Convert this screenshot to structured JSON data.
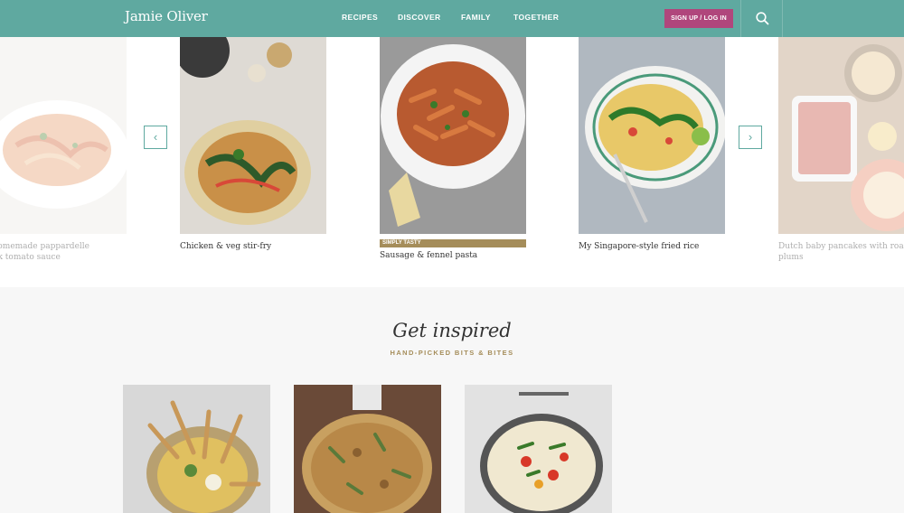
{
  "header": {
    "logo": "Jamie Oliver",
    "nav": [
      "RECIPES",
      "DISCOVER",
      "FAMILY",
      "TOGETHER"
    ],
    "signup_label": "SIGN UP / LOG IN"
  },
  "carousel": {
    "cards": [
      {
        "caption": "t's homemade pappardelle\nquick tomato sauce"
      },
      {
        "caption": "Chicken & veg stir-fry"
      },
      {
        "caption": "Sausage & fennel pasta",
        "tag": "SIMPLY TASTY"
      },
      {
        "caption": "My Singapore-style fried rice"
      },
      {
        "caption": "Dutch baby pancakes with roaste\nplums"
      }
    ]
  },
  "inspired": {
    "title": "Get inspired",
    "subtitle": "HAND-PICKED BITS & BITES"
  },
  "colors": {
    "brand": "#5fa9a0",
    "accent": "#b0467c",
    "gold": "#a58d5a"
  }
}
